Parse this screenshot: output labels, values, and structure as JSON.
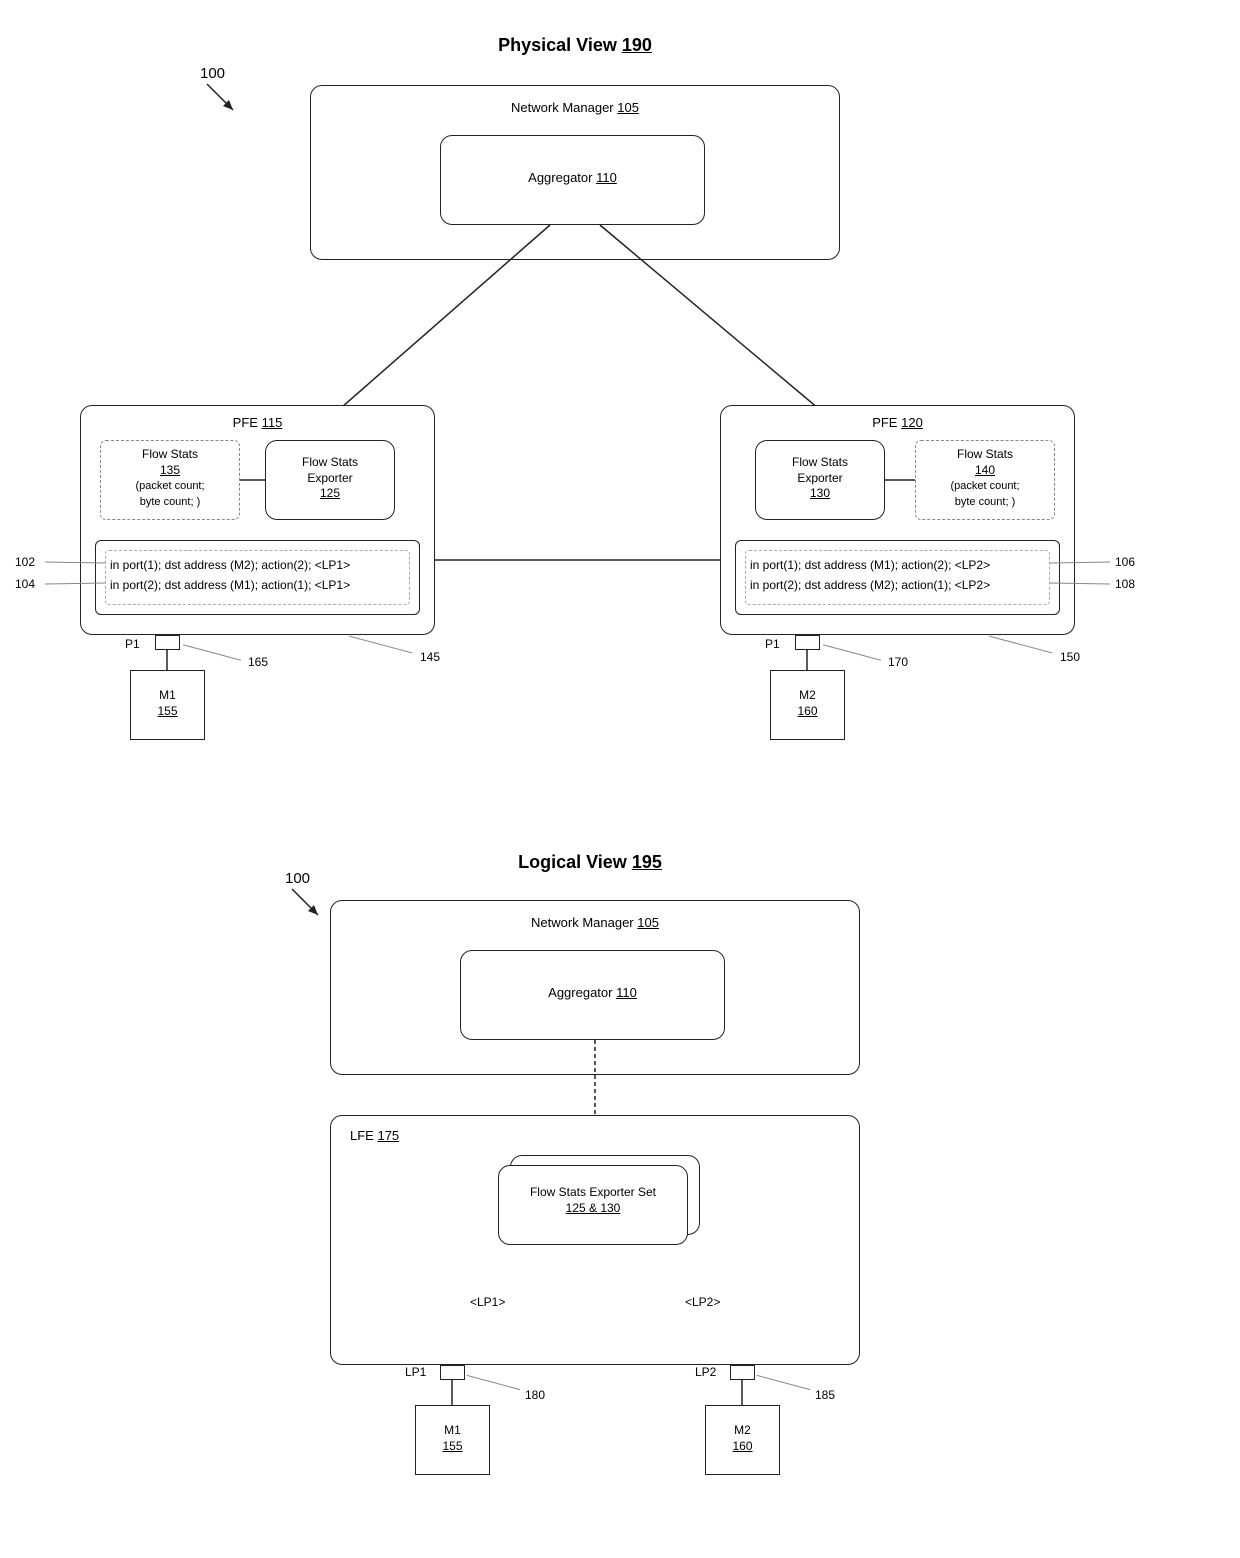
{
  "physical": {
    "title": "Physical View",
    "title_ref": "190",
    "system_ref": "100",
    "network_manager": {
      "label": "Network Manager",
      "ref": "105"
    },
    "aggregator": {
      "label": "Aggregator",
      "ref": "110"
    },
    "pfe1": {
      "label": "PFE",
      "ref": "115",
      "flow_stats": {
        "label": "Flow Stats",
        "ref": "135",
        "note": "(packet count;\nbyte count; <LP1>)"
      },
      "exporter": {
        "label": "Flow Stats\nExporter",
        "ref": "125"
      },
      "rules": {
        "r1": "in port(1); dst address (M2); action(2); <LP1>",
        "r2": "in port(2); dst address (M1); action(1); <LP1>"
      },
      "port": "P1",
      "port_ref": "165",
      "rules_ref": "145",
      "machine": {
        "label": "M1",
        "ref": "155"
      }
    },
    "pfe2": {
      "label": "PFE",
      "ref": "120",
      "flow_stats": {
        "label": "Flow Stats",
        "ref": "140",
        "note": "(packet count;\nbyte count; <LP2>)"
      },
      "exporter": {
        "label": "Flow Stats\nExporter",
        "ref": "130"
      },
      "rules": {
        "r1": "in port(1); dst address (M1); action(2); <LP2>",
        "r2": "in port(2); dst address (M2); action(1); <LP2>"
      },
      "port": "P1",
      "port_ref": "170",
      "rules_ref": "150",
      "machine": {
        "label": "M2",
        "ref": "160"
      }
    },
    "rule_refs": {
      "r102": "102",
      "r104": "104",
      "r106": "106",
      "r108": "108"
    }
  },
  "logical": {
    "title": "Logical View",
    "title_ref": "195",
    "system_ref": "100",
    "network_manager": {
      "label": "Network Manager",
      "ref": "105"
    },
    "aggregator": {
      "label": "Aggregator",
      "ref": "110"
    },
    "lfe": {
      "label": "LFE",
      "ref": "175"
    },
    "exporter_set": {
      "label": "Flow Stats Exporter Set",
      "refs": "125 & 130"
    },
    "lp1_label": "<LP1>",
    "lp2_label": "<LP2>",
    "lp1": {
      "label": "LP1",
      "ref": "180"
    },
    "lp2": {
      "label": "LP2",
      "ref": "185"
    },
    "m1": {
      "label": "M1",
      "ref": "155"
    },
    "m2": {
      "label": "M2",
      "ref": "160"
    }
  }
}
